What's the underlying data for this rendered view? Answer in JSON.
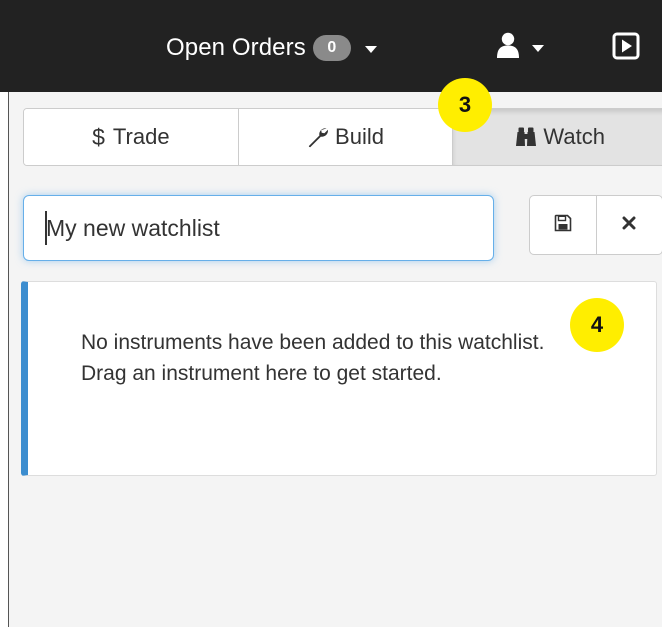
{
  "topbar": {
    "orders_label": "Open Orders",
    "orders_count": "0",
    "icons": [
      "user-icon",
      "chevron-down-icon",
      "play-icon"
    ]
  },
  "tabs": [
    {
      "label": "Trade",
      "icon": "dollar-icon",
      "symbol": "$"
    },
    {
      "label": "Build",
      "icon": "wrench-icon"
    },
    {
      "label": "Watch",
      "icon": "binoculars-icon",
      "active": true
    }
  ],
  "watchlist": {
    "name_value": "My new watchlist",
    "save_icon": "floppy-disk-icon",
    "delete_icon": "close-icon"
  },
  "empty_state": {
    "message": "No instruments have been added to this watchlist. Drag an instrument here to get started."
  },
  "markers": [
    "3",
    "4"
  ],
  "colors": {
    "topbar_bg": "#222222",
    "panel_bg": "#f4f4f4",
    "accent_blue": "#3c8dcf",
    "focus_glow": "#66afe9",
    "marker_yellow": "#ffee00",
    "badge_gray": "#8a8a8a",
    "active_tab": "#e3e3e3"
  }
}
